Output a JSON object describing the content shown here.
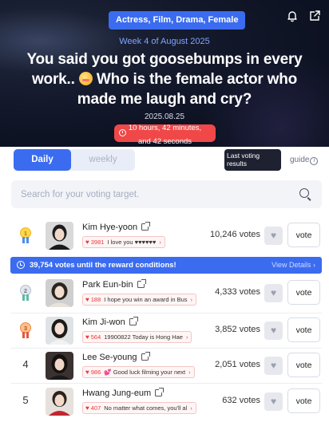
{
  "hero": {
    "category": "Actress, Film, Drama, Female",
    "week": "Week 4 of August 2025",
    "headline_part1": "You said you got goosebumps in every work..",
    "headline_part2": "Who is the female actor who made me laugh and cry?",
    "headline_emoji": "flushed-face-emoji",
    "date": "2025.08.25",
    "countdown_line1": "10 hours, 42 minutes,",
    "countdown_line2": "and 42 seconds",
    "icons": [
      "bell-icon",
      "share-icon"
    ]
  },
  "tabs": [
    {
      "label": "Daily",
      "active": true
    },
    {
      "label": "weekly",
      "active": false
    }
  ],
  "last_voting_label": "Last voting results",
  "guide_label": "guide",
  "search": {
    "placeholder": "Search for your voting target."
  },
  "banner": {
    "message": "39,754 votes until the reward conditions!",
    "details": "View Details ›"
  },
  "vote_label": "vote",
  "rankings": [
    {
      "rank": "1",
      "name": "Kim Hye-yoon",
      "comment_count": "3981",
      "comment": "I love you ♥♥♥♥♥♥",
      "votes": "10,246 votes"
    },
    {
      "rank": "2",
      "name": "Park Eun-bin",
      "comment_count": "188",
      "comment": "I hope you win an award in Bus",
      "votes": "4,333 votes"
    },
    {
      "rank": "3",
      "name": "Kim Ji-won",
      "comment_count": "564",
      "comment": "19900822 Today is Hong Hae",
      "votes": "3,852 votes"
    },
    {
      "rank": "4",
      "name": "Lee Se-young",
      "comment_count": "986",
      "comment": "💕 Good luck filming your next",
      "votes": "2,051 votes"
    },
    {
      "rank": "5",
      "name": "Hwang Jung-eum",
      "comment_count": "407",
      "comment": "No matter what comes, you'll al",
      "votes": "632 votes"
    }
  ],
  "colors": {
    "accent": "#3b6cf0",
    "alert": "#f04848",
    "dark": "#1e2230"
  }
}
